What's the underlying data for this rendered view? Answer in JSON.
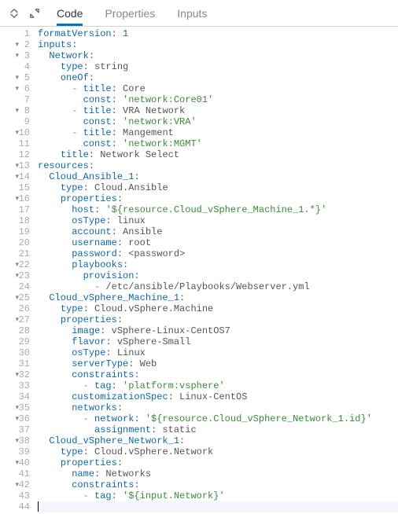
{
  "tabs": {
    "code": "Code",
    "properties": "Properties",
    "inputs": "Inputs"
  },
  "editor": {
    "lines": [
      {
        "n": 1,
        "fold": false,
        "indent": 0,
        "tokens": [
          {
            "c": "k",
            "t": "formatVersion"
          },
          {
            "c": "p",
            "t": ": "
          },
          {
            "c": "n",
            "t": "1"
          }
        ]
      },
      {
        "n": 2,
        "fold": true,
        "indent": 0,
        "tokens": [
          {
            "c": "k",
            "t": "inputs"
          },
          {
            "c": "p",
            "t": ":"
          }
        ]
      },
      {
        "n": 3,
        "fold": true,
        "indent": 1,
        "tokens": [
          {
            "c": "k",
            "t": "Network"
          },
          {
            "c": "p",
            "t": ":"
          }
        ]
      },
      {
        "n": 4,
        "fold": false,
        "indent": 2,
        "tokens": [
          {
            "c": "k",
            "t": "type"
          },
          {
            "c": "p",
            "t": ": string"
          }
        ]
      },
      {
        "n": 5,
        "fold": true,
        "indent": 2,
        "tokens": [
          {
            "c": "k",
            "t": "oneOf"
          },
          {
            "c": "p",
            "t": ":"
          }
        ]
      },
      {
        "n": 6,
        "fold": true,
        "indent": 3,
        "tokens": [
          {
            "c": "d",
            "t": "- "
          },
          {
            "c": "k",
            "t": "title"
          },
          {
            "c": "p",
            "t": ": Core"
          }
        ]
      },
      {
        "n": 7,
        "fold": false,
        "indent": 4,
        "tokens": [
          {
            "c": "k",
            "t": "const"
          },
          {
            "c": "p",
            "t": ": "
          },
          {
            "c": "s",
            "t": "'network:Core01'"
          }
        ]
      },
      {
        "n": 8,
        "fold": true,
        "indent": 3,
        "tokens": [
          {
            "c": "d",
            "t": "- "
          },
          {
            "c": "k",
            "t": "title"
          },
          {
            "c": "p",
            "t": ": VRA Network"
          }
        ]
      },
      {
        "n": 9,
        "fold": false,
        "indent": 4,
        "tokens": [
          {
            "c": "k",
            "t": "const"
          },
          {
            "c": "p",
            "t": ": "
          },
          {
            "c": "s",
            "t": "'network:VRA'"
          }
        ]
      },
      {
        "n": 10,
        "fold": true,
        "indent": 3,
        "tokens": [
          {
            "c": "d",
            "t": "- "
          },
          {
            "c": "k",
            "t": "title"
          },
          {
            "c": "p",
            "t": ": Mangement"
          }
        ]
      },
      {
        "n": 11,
        "fold": false,
        "indent": 4,
        "tokens": [
          {
            "c": "k",
            "t": "const"
          },
          {
            "c": "p",
            "t": ": "
          },
          {
            "c": "s",
            "t": "'network:MGMT'"
          }
        ]
      },
      {
        "n": 12,
        "fold": false,
        "indent": 2,
        "tokens": [
          {
            "c": "k",
            "t": "title"
          },
          {
            "c": "p",
            "t": ": Network Select"
          }
        ]
      },
      {
        "n": 13,
        "fold": true,
        "indent": 0,
        "tokens": [
          {
            "c": "k",
            "t": "resources"
          },
          {
            "c": "p",
            "t": ":"
          }
        ]
      },
      {
        "n": 14,
        "fold": true,
        "indent": 1,
        "tokens": [
          {
            "c": "k",
            "t": "Cloud_Ansible_1"
          },
          {
            "c": "p",
            "t": ":"
          }
        ]
      },
      {
        "n": 15,
        "fold": false,
        "indent": 2,
        "tokens": [
          {
            "c": "k",
            "t": "type"
          },
          {
            "c": "p",
            "t": ": Cloud.Ansible"
          }
        ]
      },
      {
        "n": 16,
        "fold": true,
        "indent": 2,
        "tokens": [
          {
            "c": "k",
            "t": "properties"
          },
          {
            "c": "p",
            "t": ":"
          }
        ]
      },
      {
        "n": 17,
        "fold": false,
        "indent": 3,
        "tokens": [
          {
            "c": "k",
            "t": "host"
          },
          {
            "c": "p",
            "t": ": "
          },
          {
            "c": "s",
            "t": "'${resource.Cloud_vSphere_Machine_1.*}'"
          }
        ]
      },
      {
        "n": 18,
        "fold": false,
        "indent": 3,
        "tokens": [
          {
            "c": "k",
            "t": "osType"
          },
          {
            "c": "p",
            "t": ": linux"
          }
        ]
      },
      {
        "n": 19,
        "fold": false,
        "indent": 3,
        "tokens": [
          {
            "c": "k",
            "t": "account"
          },
          {
            "c": "p",
            "t": ": Ansible"
          }
        ]
      },
      {
        "n": 20,
        "fold": false,
        "indent": 3,
        "tokens": [
          {
            "c": "k",
            "t": "username"
          },
          {
            "c": "p",
            "t": ": root"
          }
        ]
      },
      {
        "n": 21,
        "fold": false,
        "indent": 3,
        "tokens": [
          {
            "c": "k",
            "t": "password"
          },
          {
            "c": "p",
            "t": ": <password>"
          }
        ]
      },
      {
        "n": 22,
        "fold": true,
        "indent": 3,
        "tokens": [
          {
            "c": "k",
            "t": "playbooks"
          },
          {
            "c": "p",
            "t": ":"
          }
        ]
      },
      {
        "n": 23,
        "fold": true,
        "indent": 4,
        "tokens": [
          {
            "c": "k",
            "t": "provision"
          },
          {
            "c": "p",
            "t": ":"
          }
        ]
      },
      {
        "n": 24,
        "fold": false,
        "indent": 5,
        "tokens": [
          {
            "c": "d",
            "t": "- "
          },
          {
            "c": "p",
            "t": "/etc/ansible/Playbooks/Webserver.yml"
          }
        ]
      },
      {
        "n": 25,
        "fold": true,
        "indent": 1,
        "tokens": [
          {
            "c": "k",
            "t": "Cloud_vSphere_Machine_1"
          },
          {
            "c": "p",
            "t": ":"
          }
        ]
      },
      {
        "n": 26,
        "fold": false,
        "indent": 2,
        "tokens": [
          {
            "c": "k",
            "t": "type"
          },
          {
            "c": "p",
            "t": ": Cloud.vSphere.Machine"
          }
        ]
      },
      {
        "n": 27,
        "fold": true,
        "indent": 2,
        "tokens": [
          {
            "c": "k",
            "t": "properties"
          },
          {
            "c": "p",
            "t": ":"
          }
        ]
      },
      {
        "n": 28,
        "fold": false,
        "indent": 3,
        "tokens": [
          {
            "c": "k",
            "t": "image"
          },
          {
            "c": "p",
            "t": ": vSphere-Linux-CentOS7"
          }
        ]
      },
      {
        "n": 29,
        "fold": false,
        "indent": 3,
        "tokens": [
          {
            "c": "k",
            "t": "flavor"
          },
          {
            "c": "p",
            "t": ": vSphere-Small"
          }
        ]
      },
      {
        "n": 30,
        "fold": false,
        "indent": 3,
        "tokens": [
          {
            "c": "k",
            "t": "osType"
          },
          {
            "c": "p",
            "t": ": Linux"
          }
        ]
      },
      {
        "n": 31,
        "fold": false,
        "indent": 3,
        "tokens": [
          {
            "c": "k",
            "t": "serverType"
          },
          {
            "c": "p",
            "t": ": Web"
          }
        ]
      },
      {
        "n": 32,
        "fold": true,
        "indent": 3,
        "tokens": [
          {
            "c": "k",
            "t": "constraints"
          },
          {
            "c": "p",
            "t": ":"
          }
        ]
      },
      {
        "n": 33,
        "fold": false,
        "indent": 4,
        "tokens": [
          {
            "c": "d",
            "t": "- "
          },
          {
            "c": "k",
            "t": "tag"
          },
          {
            "c": "p",
            "t": ": "
          },
          {
            "c": "s",
            "t": "'platform:vsphere'"
          }
        ]
      },
      {
        "n": 34,
        "fold": false,
        "indent": 3,
        "tokens": [
          {
            "c": "k",
            "t": "customizationSpec"
          },
          {
            "c": "p",
            "t": ": Linux-CentOS"
          }
        ]
      },
      {
        "n": 35,
        "fold": true,
        "indent": 3,
        "tokens": [
          {
            "c": "k",
            "t": "networks"
          },
          {
            "c": "p",
            "t": ":"
          }
        ]
      },
      {
        "n": 36,
        "fold": true,
        "indent": 4,
        "tokens": [
          {
            "c": "d",
            "t": "- "
          },
          {
            "c": "k",
            "t": "network"
          },
          {
            "c": "p",
            "t": ": "
          },
          {
            "c": "s",
            "t": "'${resource.Cloud_vSphere_Network_1.id}'"
          }
        ]
      },
      {
        "n": 37,
        "fold": false,
        "indent": 5,
        "tokens": [
          {
            "c": "k",
            "t": "assignment"
          },
          {
            "c": "p",
            "t": ": static"
          }
        ]
      },
      {
        "n": 38,
        "fold": true,
        "indent": 1,
        "tokens": [
          {
            "c": "k",
            "t": "Cloud_vSphere_Network_1"
          },
          {
            "c": "p",
            "t": ":"
          }
        ]
      },
      {
        "n": 39,
        "fold": false,
        "indent": 2,
        "tokens": [
          {
            "c": "k",
            "t": "type"
          },
          {
            "c": "p",
            "t": ": Cloud.vSphere.Network"
          }
        ]
      },
      {
        "n": 40,
        "fold": true,
        "indent": 2,
        "tokens": [
          {
            "c": "k",
            "t": "properties"
          },
          {
            "c": "p",
            "t": ":"
          }
        ]
      },
      {
        "n": 41,
        "fold": false,
        "indent": 3,
        "tokens": [
          {
            "c": "k",
            "t": "name"
          },
          {
            "c": "p",
            "t": ": Networks"
          }
        ]
      },
      {
        "n": 42,
        "fold": true,
        "indent": 3,
        "tokens": [
          {
            "c": "k",
            "t": "constraints"
          },
          {
            "c": "p",
            "t": ":"
          }
        ]
      },
      {
        "n": 43,
        "fold": false,
        "indent": 4,
        "tokens": [
          {
            "c": "d",
            "t": "- "
          },
          {
            "c": "k",
            "t": "tag"
          },
          {
            "c": "p",
            "t": ": "
          },
          {
            "c": "s",
            "t": "'${input.Network}'"
          }
        ]
      },
      {
        "n": 44,
        "fold": false,
        "indent": 0,
        "tokens": [],
        "cursor": true
      }
    ]
  }
}
